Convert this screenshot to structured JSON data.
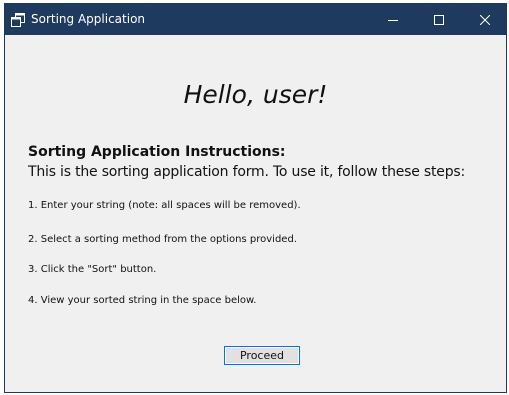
{
  "window": {
    "title": "Sorting Application",
    "icon": "app-window-icon",
    "controls": {
      "minimize_icon": "minimize-icon",
      "maximize_icon": "maximize-icon",
      "close_icon": "close-icon"
    },
    "titlebar_color": "#1f3a5f"
  },
  "content": {
    "greeting": "Hello, user!",
    "instructions_title": "Sorting Application Instructions:",
    "instructions_desc": "This is the sorting application form. To use it, follow these steps:",
    "steps": [
      "1. Enter your string (note: all spaces will be removed).",
      "2. Select a sorting method from the options provided.",
      "3. Click the \"Sort\" button.",
      "4. View your sorted string in the space below."
    ],
    "proceed_label": "Proceed"
  }
}
